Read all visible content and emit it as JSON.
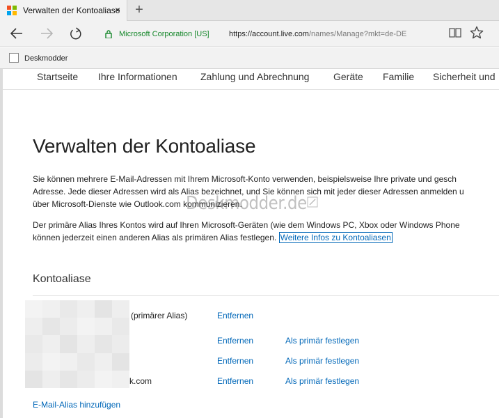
{
  "browser": {
    "tab": {
      "title": "Verwalten der Kontoaliase",
      "close_glyph": "×",
      "favicon": "microsoft-logo-icon",
      "favicon_colors": [
        "#f25022",
        "#7fba00",
        "#00a4ef",
        "#ffb900"
      ]
    },
    "new_tab_glyph": "+",
    "nav_icons": [
      "back-arrow-icon",
      "forward-arrow-icon",
      "refresh-icon"
    ],
    "address": {
      "certificate": "Microsoft Corporation [US]",
      "url_host": "https://account.live.com",
      "url_rest": "/names/Manage?mkt=de-DE",
      "cert_color": "#15872a"
    },
    "toolbar_icons": [
      "reading-view-icon",
      "favorite-star-icon"
    ],
    "favorites": [
      {
        "label": "Deskmodder",
        "icon": "page-icon"
      }
    ]
  },
  "subnav": {
    "items": [
      "Startseite",
      "Ihre Informationen",
      "Zahlung und Abrechnung",
      "Geräte",
      "Familie",
      "Sicherheit und"
    ]
  },
  "page": {
    "title": "Verwalten der Kontoaliase",
    "paragraph1": [
      "Sie können mehrere E-Mail-Adressen mit Ihrem Microsoft-Konto verwenden, beispielsweise Ihre private und gesch",
      "Adresse. Jede dieser Adressen wird als Alias bezeichnet, und Sie können sich mit jeder dieser Adressen anmelden u",
      "über Microsoft-Dienste wie Outlook.com kommunizieren."
    ],
    "paragraph2_line1": "Der primäre Alias Ihres Kontos wird auf Ihren Microsoft-Geräten (wie dem Windows PC, Xbox oder Windows Phone",
    "paragraph2_line2": "können jederzeit einen anderen Alias als primären Alias festlegen.",
    "learn_more_link": "Weitere Infos zu Kontoaliasen",
    "watermark": "Deskmodder.de",
    "section_heading": "Kontoaliase",
    "aliases": [
      {
        "text": "(primärer Alias)",
        "remove": "Entfernen",
        "make_primary": ""
      },
      {
        "text": "",
        "remove": "Entfernen",
        "make_primary": "Als primär festlegen"
      },
      {
        "text": "",
        "remove": "Entfernen",
        "make_primary": "Als primär festlegen"
      },
      {
        "text": "k.com",
        "remove": "Entfernen",
        "make_primary": "Als primär festlegen"
      }
    ],
    "add_alias": "E-Mail-Alias hinzufügen",
    "link_color": "#0067b8"
  }
}
